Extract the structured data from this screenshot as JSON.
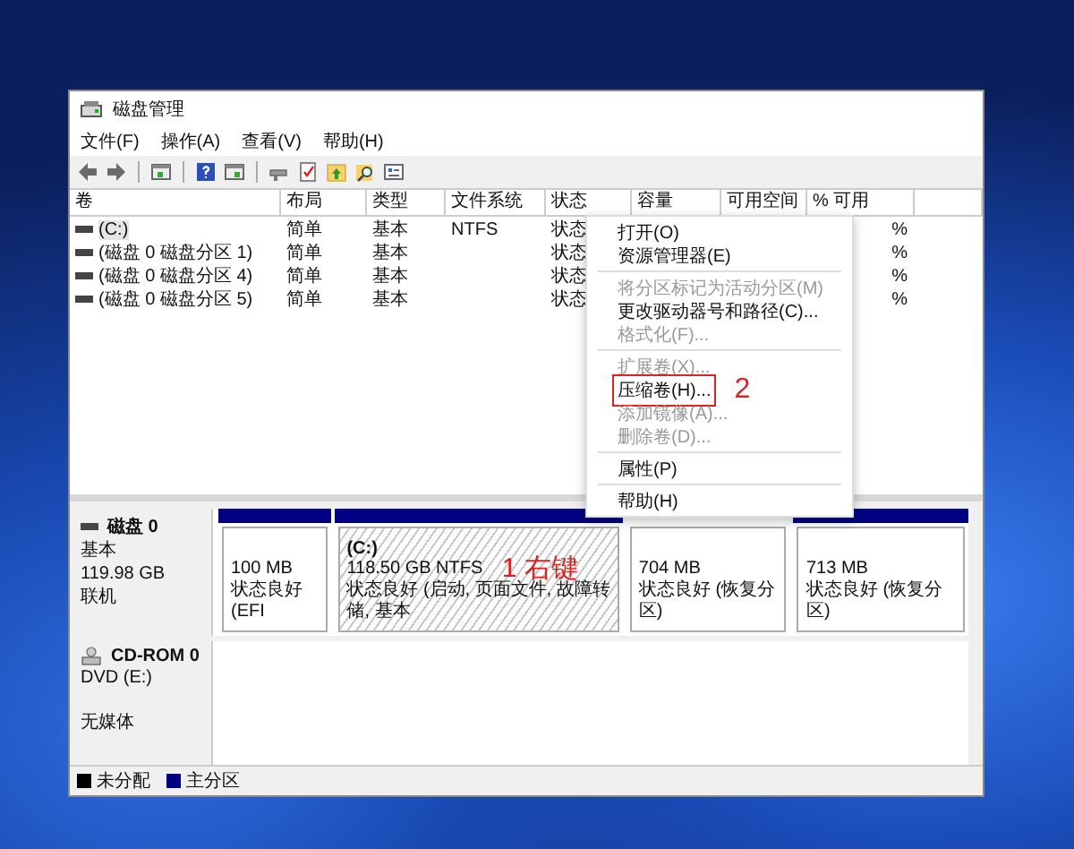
{
  "window": {
    "title": "磁盘管理"
  },
  "menu_bar": [
    "文件(F)",
    "操作(A)",
    "查看(V)",
    "帮助(H)"
  ],
  "table": {
    "columns": [
      "卷",
      "布局",
      "类型",
      "文件系统",
      "状态",
      "容量",
      "可用空间",
      "% 可用"
    ],
    "rows": [
      {
        "cells": [
          "(C:)",
          "简单",
          "基本",
          "NTFS",
          "状态",
          "",
          "",
          "%"
        ],
        "selected": true
      },
      {
        "cells": [
          "(磁盘 0 磁盘分区 1)",
          "简单",
          "基本",
          "",
          "状态",
          "",
          "",
          "%"
        ],
        "selected": false
      },
      {
        "cells": [
          "(磁盘 0 磁盘分区 4)",
          "简单",
          "基本",
          "",
          "状态",
          "",
          "",
          "%"
        ],
        "selected": false
      },
      {
        "cells": [
          "(磁盘 0 磁盘分区 5)",
          "简单",
          "基本",
          "",
          "状态",
          "",
          "",
          "%"
        ],
        "selected": false
      }
    ]
  },
  "context_menu": [
    {
      "kind": "item",
      "label": "打开(O)",
      "disabled": false,
      "highlighted": false
    },
    {
      "kind": "item",
      "label": "资源管理器(E)",
      "disabled": false,
      "highlighted": false
    },
    {
      "kind": "separator"
    },
    {
      "kind": "item",
      "label": "将分区标记为活动分区(M)",
      "disabled": true,
      "highlighted": false
    },
    {
      "kind": "item",
      "label": "更改驱动器号和路径(C)...",
      "disabled": false,
      "highlighted": false
    },
    {
      "kind": "item",
      "label": "格式化(F)...",
      "disabled": true,
      "highlighted": false
    },
    {
      "kind": "separator"
    },
    {
      "kind": "item",
      "label": "扩展卷(X)...",
      "disabled": true,
      "highlighted": false
    },
    {
      "kind": "item",
      "label": "压缩卷(H)...",
      "disabled": false,
      "highlighted": true,
      "callout": "2"
    },
    {
      "kind": "item",
      "label": "添加镜像(A)...",
      "disabled": true,
      "highlighted": false
    },
    {
      "kind": "item",
      "label": "删除卷(D)...",
      "disabled": true,
      "highlighted": false
    },
    {
      "kind": "separator"
    },
    {
      "kind": "item",
      "label": "属性(P)",
      "disabled": false,
      "highlighted": false
    },
    {
      "kind": "separator"
    },
    {
      "kind": "item",
      "label": "帮助(H)",
      "disabled": false,
      "highlighted": false
    }
  ],
  "disks": [
    {
      "kind": "disk",
      "name": "磁盘 0",
      "lines": [
        "基本",
        "119.98 GB",
        "联机"
      ],
      "partitions": [
        {
          "size": "100 MB",
          "status": "状态良好 (EFI",
          "selected": false,
          "color": "#000080"
        },
        {
          "label": "(C:)",
          "size": "118.50 GB NTFS",
          "status": "状态良好 (启动, 页面文件, 故障转储, 基本",
          "selected": true,
          "color": "#000080",
          "callout": "1 右键"
        },
        {
          "size": "704 MB",
          "status": "状态良好 (恢复分区)",
          "selected": false
        },
        {
          "size": "713 MB",
          "status": "状态良好 (恢复分区)",
          "selected": false,
          "color": "#000080"
        }
      ]
    },
    {
      "kind": "cdrom",
      "name": "CD-ROM 0",
      "lines": [
        "DVD (E:)",
        "无媒体"
      ]
    }
  ],
  "legend": [
    {
      "label": "未分配",
      "color": "#000000"
    },
    {
      "label": "主分区",
      "color": "#000080"
    }
  ]
}
